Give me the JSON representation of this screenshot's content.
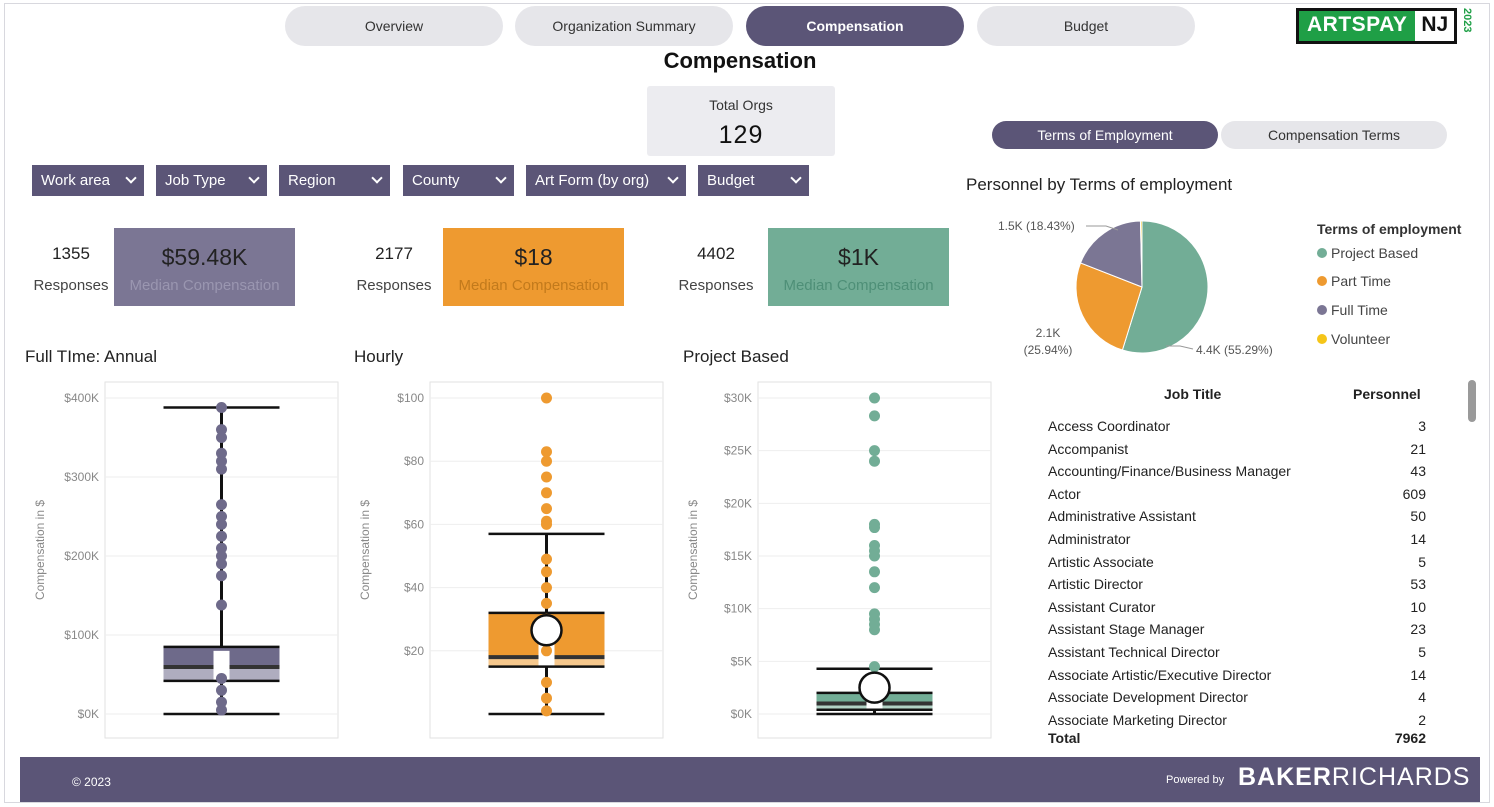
{
  "nav": {
    "tabs": [
      {
        "label": "Overview",
        "active": false
      },
      {
        "label": "Organization Summary",
        "active": false
      },
      {
        "label": "Compensation",
        "active": true
      },
      {
        "label": "Budget",
        "active": false
      }
    ]
  },
  "logo": {
    "part1": "ARTSPAY",
    "part2": "NJ",
    "year": "2023"
  },
  "page_title": "Compensation",
  "total_orgs": {
    "label": "Total Orgs",
    "value": "129"
  },
  "toggle": {
    "terms_employment": "Terms of Employment",
    "compensation_terms": "Compensation Terms"
  },
  "filters": [
    "Work area",
    "Job Type",
    "Region",
    "County",
    "Art Form (by org)",
    "Budget"
  ],
  "kpis": [
    {
      "responses": "1355",
      "responses_label": "Responses",
      "value": "$59.48K",
      "label": "Median Compensation",
      "color": "#7b7694"
    },
    {
      "responses": "2177",
      "responses_label": "Responses",
      "value": "$18",
      "label": "Median Compensation",
      "color": "#ee9a30"
    },
    {
      "responses": "4402",
      "responses_label": "Responses",
      "value": "$1K",
      "label": "Median Compensation",
      "color": "#72ad96"
    }
  ],
  "charts": {
    "full_time_title": "Full TIme: Annual",
    "hourly_title": "Hourly",
    "project_title": "Project Based",
    "y_axis_label": "Compensation in $"
  },
  "chart_data": [
    {
      "type": "box",
      "title": "Full TIme: Annual",
      "ylabel": "Compensation in $",
      "yticks": [
        "$0K",
        "$100K",
        "$200K",
        "$300K",
        "$400K"
      ],
      "ylim": [
        0,
        400000
      ],
      "whisker_low": 0,
      "q1": 42000,
      "median": 59480,
      "q3": 85000,
      "whisker_high": 388000,
      "color": "#6e6a8a",
      "outliers": [
        388000,
        360000,
        350000,
        330000,
        320000,
        310000,
        265000,
        250000,
        240000,
        225000,
        210000,
        200000,
        190000,
        175000,
        138000,
        45000,
        30000,
        15000,
        5000
      ]
    },
    {
      "type": "box",
      "title": "Hourly",
      "ylabel": "Compensation in $",
      "yticks": [
        "$20",
        "$40",
        "$60",
        "$80",
        "$100"
      ],
      "ylim": [
        0,
        100
      ],
      "whisker_low": 0,
      "q1": 15,
      "median": 18,
      "q3": 32,
      "whisker_high": 57,
      "mean": 26.5,
      "color": "#ee9a30",
      "outliers": [
        100,
        83,
        80,
        75,
        70,
        65,
        61,
        60,
        49,
        45,
        40,
        35,
        30,
        25,
        20,
        10,
        5,
        1
      ]
    },
    {
      "type": "box",
      "title": "Project Based",
      "ylabel": "Compensation in $",
      "yticks": [
        "$0K",
        "$5K",
        "$10K",
        "$15K",
        "$20K",
        "$25K",
        "$30K"
      ],
      "ylim": [
        0,
        30000
      ],
      "whisker_low": 0,
      "q1": 400,
      "median": 1000,
      "q3": 2000,
      "whisker_high": 4300,
      "mean": 2500,
      "color": "#72ad96",
      "outliers": [
        30000,
        28300,
        25000,
        24000,
        18000,
        17700,
        16000,
        15500,
        15000,
        13500,
        12000,
        9500,
        9000,
        8500,
        8000,
        4500
      ]
    },
    {
      "type": "pie",
      "title": "Personnel by Terms of employment",
      "legend_title": "Terms of employment",
      "legend_position": "right",
      "slices": [
        {
          "name": "Project Based",
          "value": 4400,
          "percent": 55.29,
          "color": "#72ad96",
          "label": "4.4K (55.29%)"
        },
        {
          "name": "Part Time",
          "value": 2100,
          "percent": 25.94,
          "color": "#ee9a30",
          "label": "2.1K (25.94%)"
        },
        {
          "name": "Full Time",
          "value": 1500,
          "percent": 18.43,
          "color": "#7b7694",
          "label": "1.5K (18.43%)"
        },
        {
          "name": "Volunteer",
          "value": 30,
          "percent": 0.34,
          "color": "#f5c518",
          "label": ""
        }
      ]
    }
  ],
  "table": {
    "headers": [
      "Job Title",
      "Personnel"
    ],
    "rows": [
      [
        "Access Coordinator",
        "3"
      ],
      [
        "Accompanist",
        "21"
      ],
      [
        "Accounting/Finance/Business Manager",
        "43"
      ],
      [
        "Actor",
        "609"
      ],
      [
        "Administrative Assistant",
        "50"
      ],
      [
        "Administrator",
        "14"
      ],
      [
        "Artistic Associate",
        "5"
      ],
      [
        "Artistic Director",
        "53"
      ],
      [
        "Assistant Curator",
        "10"
      ],
      [
        "Assistant Stage Manager",
        "23"
      ],
      [
        "Assistant Technical Director",
        "5"
      ],
      [
        "Associate Artistic/Executive Director",
        "14"
      ],
      [
        "Associate Development Director",
        "4"
      ],
      [
        "Associate Marketing Director",
        "2"
      ]
    ],
    "total": [
      "Total",
      "7962"
    ]
  },
  "footer": {
    "copyright": "© 2023",
    "powered_by": "Powered by",
    "brand_bold": "BAKER",
    "brand_rest": "RICHARDS"
  }
}
